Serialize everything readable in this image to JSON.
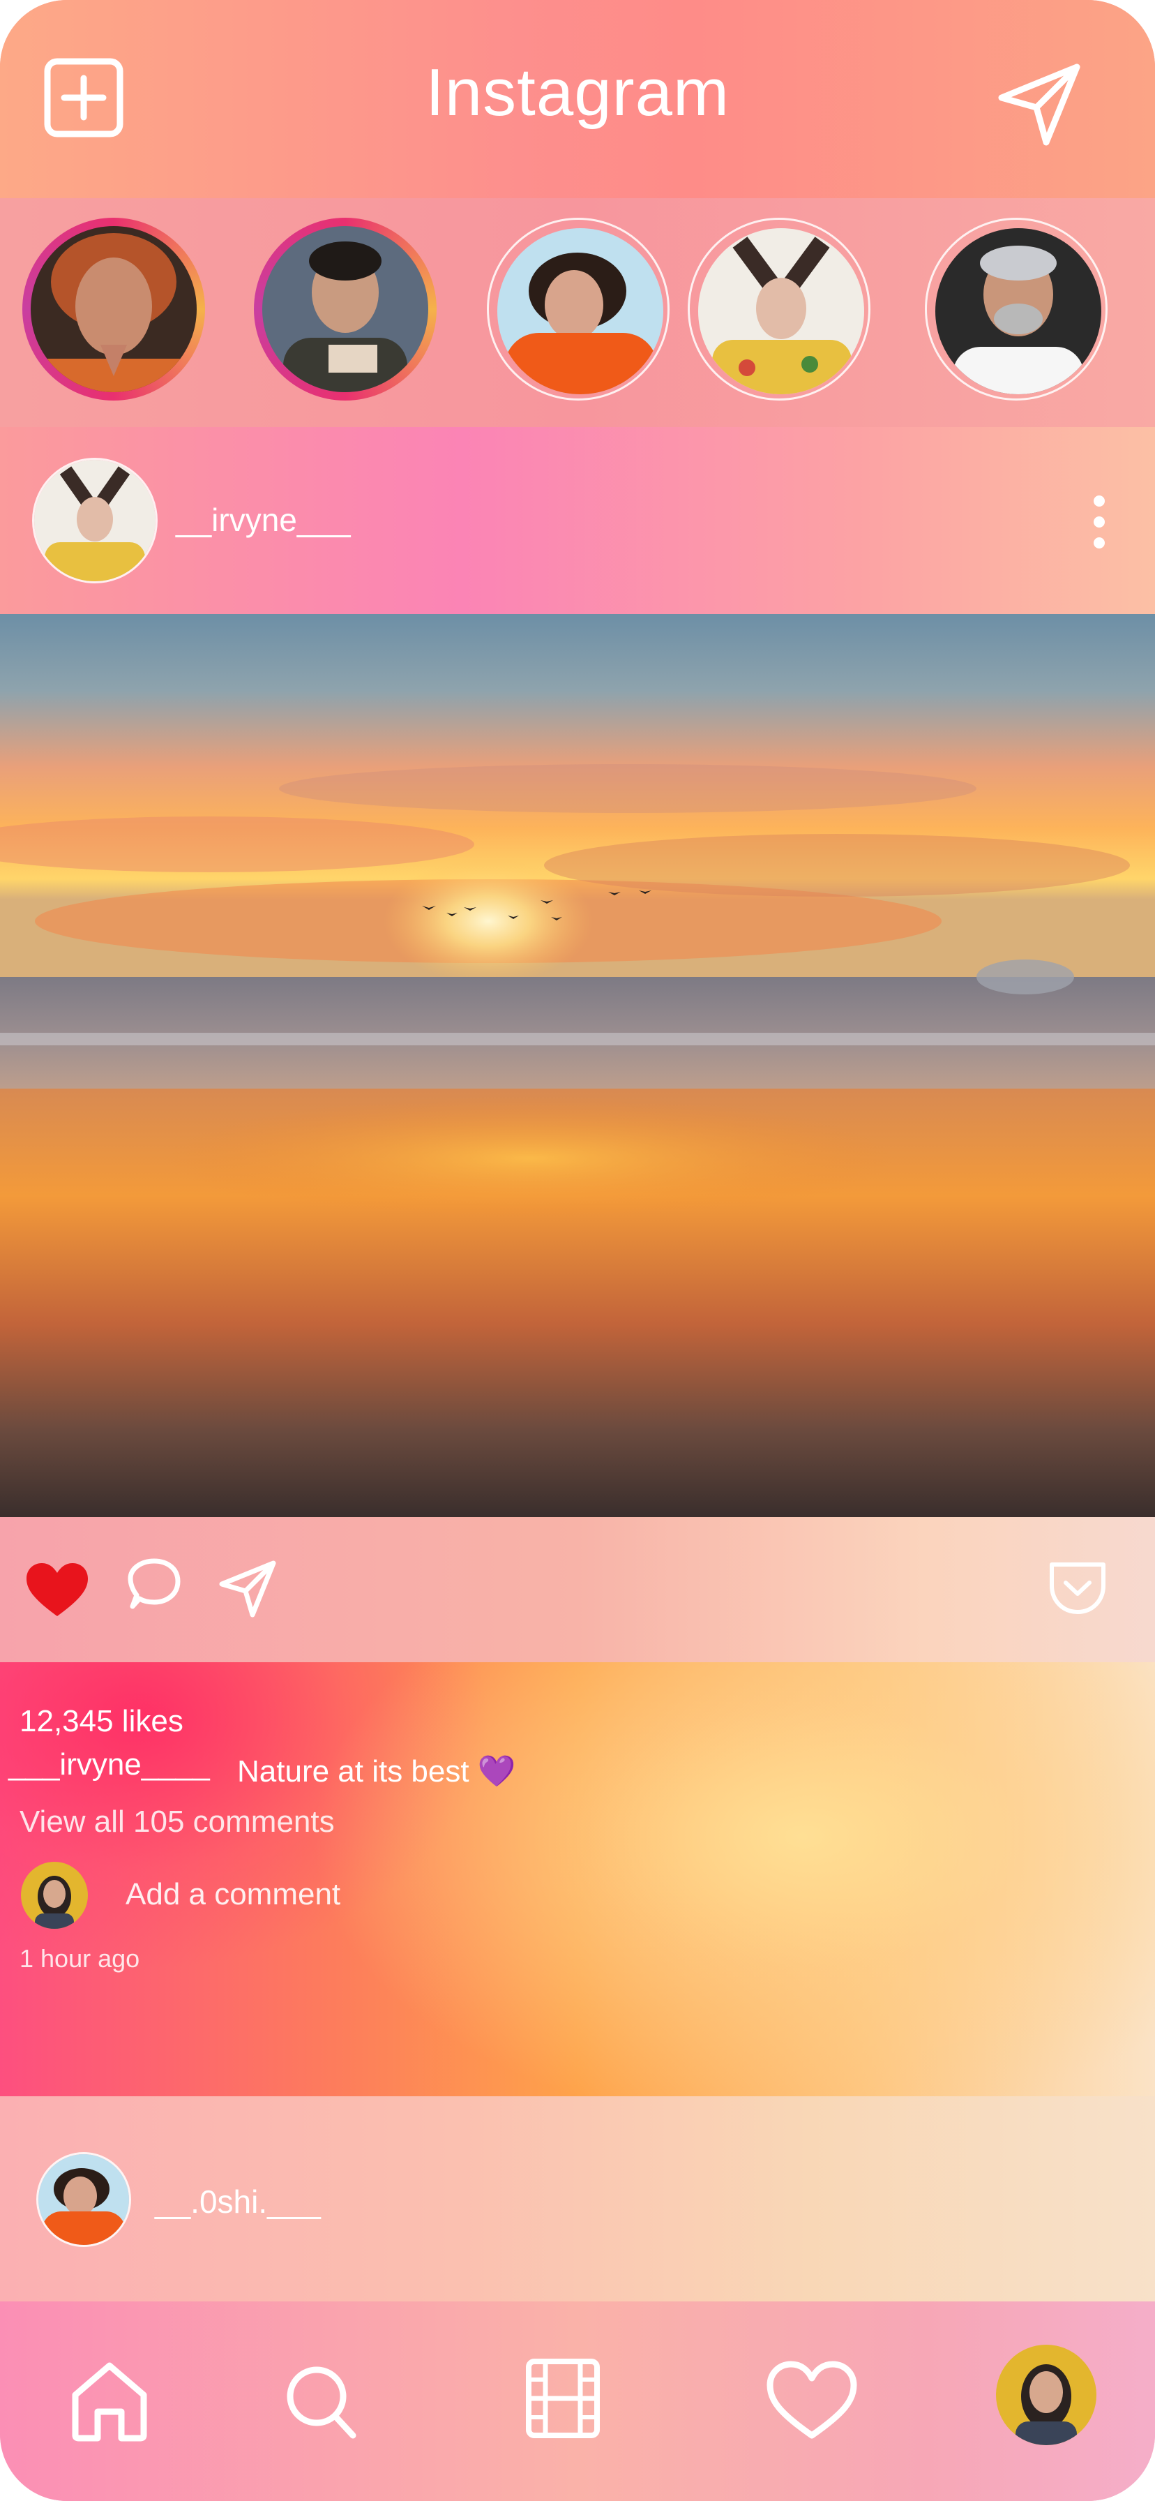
{
  "app": {
    "title": "Instagram",
    "new_post_icon": "plus-square-icon",
    "direct_icon": "paper-plane-icon"
  },
  "stories": [
    {
      "name": "story-1",
      "ring": "gradient",
      "photo_colors": [
        "#3b2a22",
        "#d86a2c",
        "#c98c6f"
      ]
    },
    {
      "name": "story-2",
      "ring": "gradient",
      "photo_colors": [
        "#5d6b7e",
        "#3a3a33",
        "#e6d6c4"
      ]
    },
    {
      "name": "story-3",
      "ring": "white",
      "photo_colors": [
        "#bfe0ef",
        "#f05a18",
        "#2b1d17"
      ]
    },
    {
      "name": "story-4",
      "ring": "white",
      "photo_colors": [
        "#f1ede6",
        "#e8c040",
        "#3a2b26"
      ]
    },
    {
      "name": "story-5",
      "ring": "white",
      "photo_colors": [
        "#2a2a2a",
        "#c9cbd0",
        "#f6f6f6"
      ]
    }
  ],
  "post": {
    "username": "__irvyne___",
    "more_icon": "more-vertical-icon",
    "image_alt_scene": "sunset-beach",
    "likes": "12,345 likes",
    "caption_user": "___irvyne____",
    "caption_text": "Nature at its best 💜",
    "comments_link": "View all 105 comments",
    "add_comment_placeholder": "Add a comment",
    "time": "1 hour ago",
    "liked": true
  },
  "next_post": {
    "username": "__.0shi.___"
  },
  "nav": {
    "items": [
      "home-icon",
      "search-icon",
      "reels-icon",
      "heart-icon",
      "profile-avatar"
    ]
  },
  "colors": {
    "like_red": "#e8141c",
    "white": "#ffffff"
  }
}
